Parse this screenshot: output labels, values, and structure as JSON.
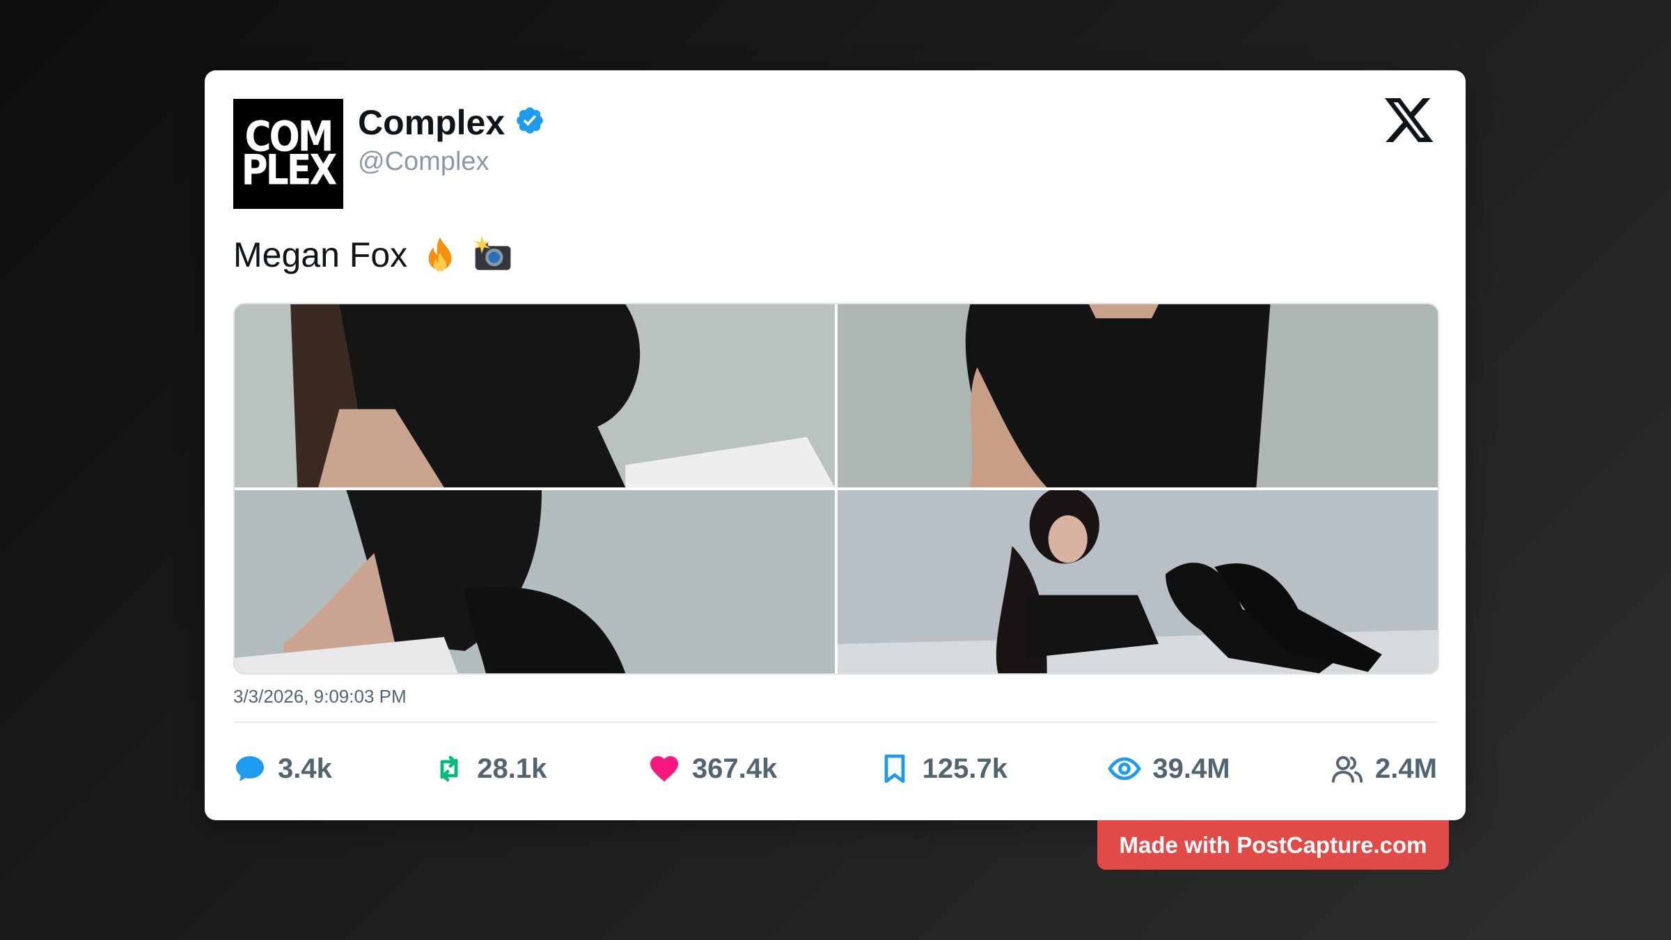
{
  "tweet": {
    "author_name": "Complex",
    "handle": "@Complex",
    "avatar_text": [
      "COM",
      "PLEX"
    ],
    "text": "Megan Fox",
    "emojis": [
      "fire-emoji",
      "camera-flash-emoji"
    ],
    "timestamp": "3/3/2026, 9:09:03 PM",
    "media": [
      {
        "name": "photo-1",
        "alt": ""
      },
      {
        "name": "photo-2",
        "alt": ""
      },
      {
        "name": "photo-3",
        "alt": ""
      },
      {
        "name": "photo-4",
        "alt": ""
      }
    ]
  },
  "stats": {
    "replies": "3.4k",
    "retweets": "28.1k",
    "likes": "367.4k",
    "bookmarks": "125.7k",
    "views": "39.4M",
    "followers": "2.4M"
  },
  "icons": {
    "platform": "x-logo-icon",
    "verified": "verified-badge-icon",
    "replies": "speech-bubble-icon",
    "retweets": "retweet-icon",
    "likes": "heart-icon",
    "bookmarks": "bookmark-icon",
    "views": "eye-icon",
    "followers": "users-icon"
  },
  "colors": {
    "verified": "#1d9bf0",
    "reply": "#1d9bf0",
    "retweet": "#00ba7c",
    "like": "#f91880",
    "bookmark": "#1d9bf0",
    "views": "#1d9bf0",
    "followers": "#536471",
    "badge": "#e14a47"
  },
  "watermark": "Made with PostCapture.com"
}
